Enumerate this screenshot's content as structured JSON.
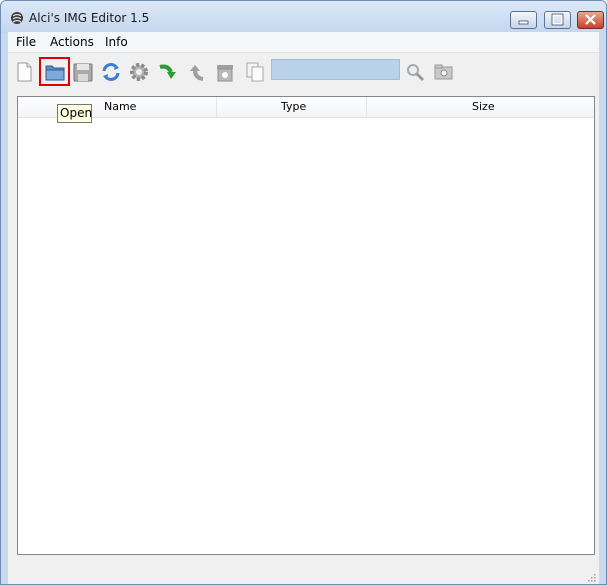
{
  "window": {
    "title": "Alci's IMG Editor 1.5"
  },
  "menu": {
    "items": [
      "File",
      "Actions",
      "Info"
    ]
  },
  "toolbar": {
    "buttons": [
      {
        "name": "new-icon"
      },
      {
        "name": "open-icon",
        "highlighted": true
      },
      {
        "name": "save-icon"
      },
      {
        "name": "refresh-icon"
      },
      {
        "name": "settings-icon"
      },
      {
        "name": "import-icon"
      },
      {
        "name": "export-icon"
      },
      {
        "name": "delete-icon"
      },
      {
        "name": "copy-icon"
      }
    ],
    "search": {
      "value": "",
      "placeholder": ""
    },
    "search_button_icon": "magnifier-icon",
    "find_button_icon": "find-icon"
  },
  "tooltip": {
    "text": "Open"
  },
  "file_list": {
    "columns": [
      "Name",
      "Type",
      "Size"
    ],
    "rows": []
  },
  "colors": {
    "highlight_border": "#e00000",
    "search_bg": "#b9d1ea",
    "tooltip_bg": "#ffffe1"
  }
}
